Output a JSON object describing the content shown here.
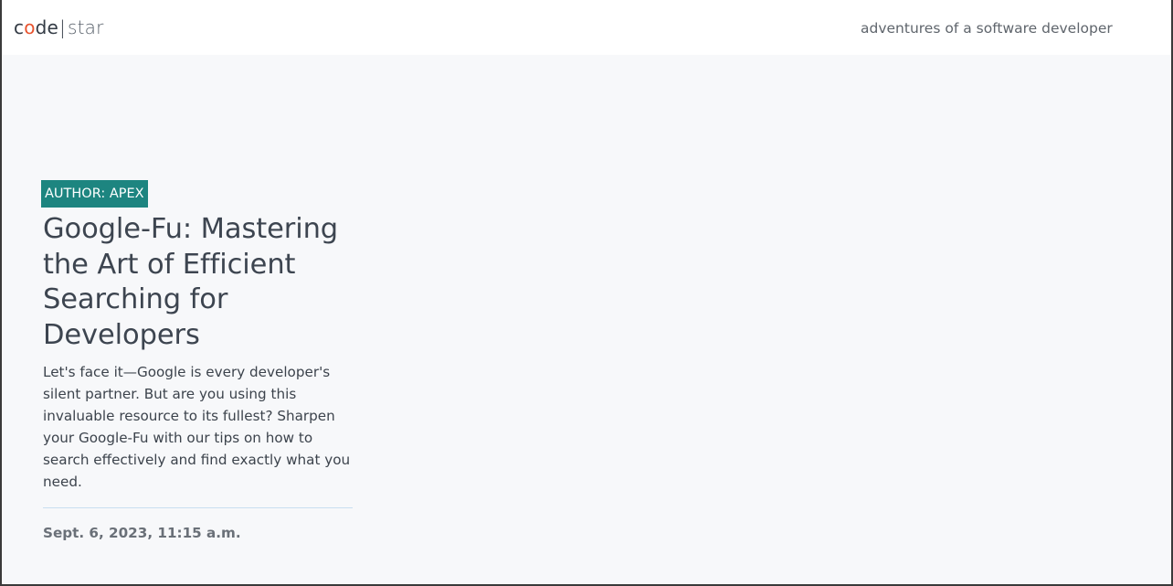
{
  "site": {
    "brand": {
      "part1": "c",
      "part2": "o",
      "part3": "de",
      "separator": "|",
      "part4": "star"
    },
    "tagline": "adventures of a software developer"
  },
  "article": {
    "author_badge": "AUTHOR: APEX",
    "title": "Google-Fu: Mastering the Art of Efficient Searching for Developers",
    "excerpt": "Let's face it—Google is every developer's silent partner. But are you using this invaluable resource to its fullest? Sharpen your Google-Fu with our tips on how to search effectively and find exactly what you need.",
    "date": "Sept. 6, 2023, 11:15 a.m."
  },
  "colors": {
    "accent_badge": "#1d8580",
    "brand_o": "#e8542f",
    "page_background": "#f7f8fa",
    "navbar_background": "#ffffff"
  }
}
